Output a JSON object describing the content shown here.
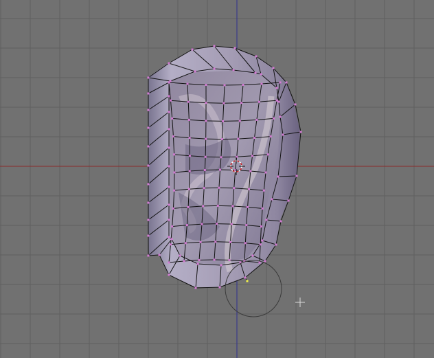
{
  "viewport": {
    "view": "front-ortho",
    "background_color": "#717171",
    "grid_color": "#5f5f5f",
    "x_axis_color": "#8a2b2b",
    "z_axis_color": "#2f2f8f",
    "grid_visible": true
  },
  "mesh": {
    "object": "ear",
    "mode": "edit",
    "shading": "solid",
    "wire_color": "#111111",
    "vertex_color": "#d37bd3",
    "selected_vertex_color": "#f2f24a",
    "surface_color": "#9890a8",
    "grid_rows": 10,
    "grid_cols": 6
  },
  "tools": {
    "origin": "3d-cursor",
    "brush": "proportional-edit-circle",
    "mouse_cursor": "crosshair"
  }
}
